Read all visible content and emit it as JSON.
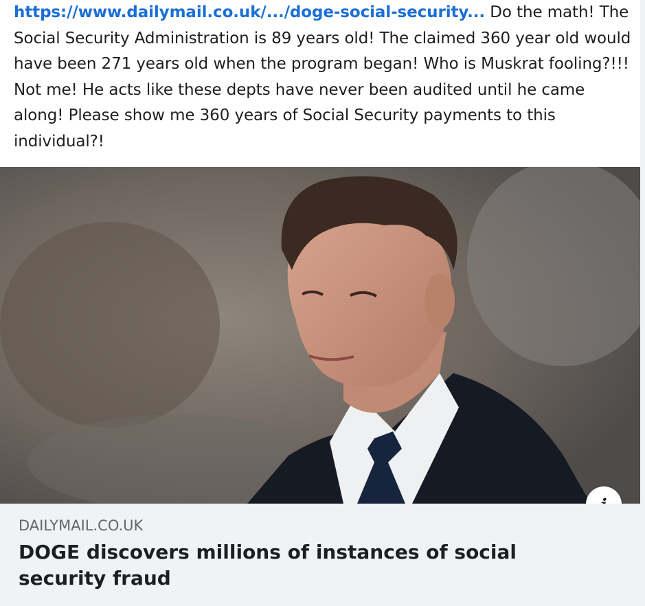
{
  "post": {
    "link_text": "https://www.dailymail.co.uk/.../doge-social-security...",
    "body_text": " Do the math! The Social Security Administration is 89 years old! The claimed 360 year old would have been 271 years old when the program began! Who is Muskrat fooling?!!! Not me! He acts like these depts have never been audited until he came along! Please show me 360 years of Social Security payments to this individual?!"
  },
  "preview": {
    "domain": "DAILYMAIL.CO.UK",
    "headline": "DOGE discovers millions of instances of social security fraud",
    "info_icon_glyph": "i"
  },
  "icons": {
    "info": "info-icon"
  }
}
